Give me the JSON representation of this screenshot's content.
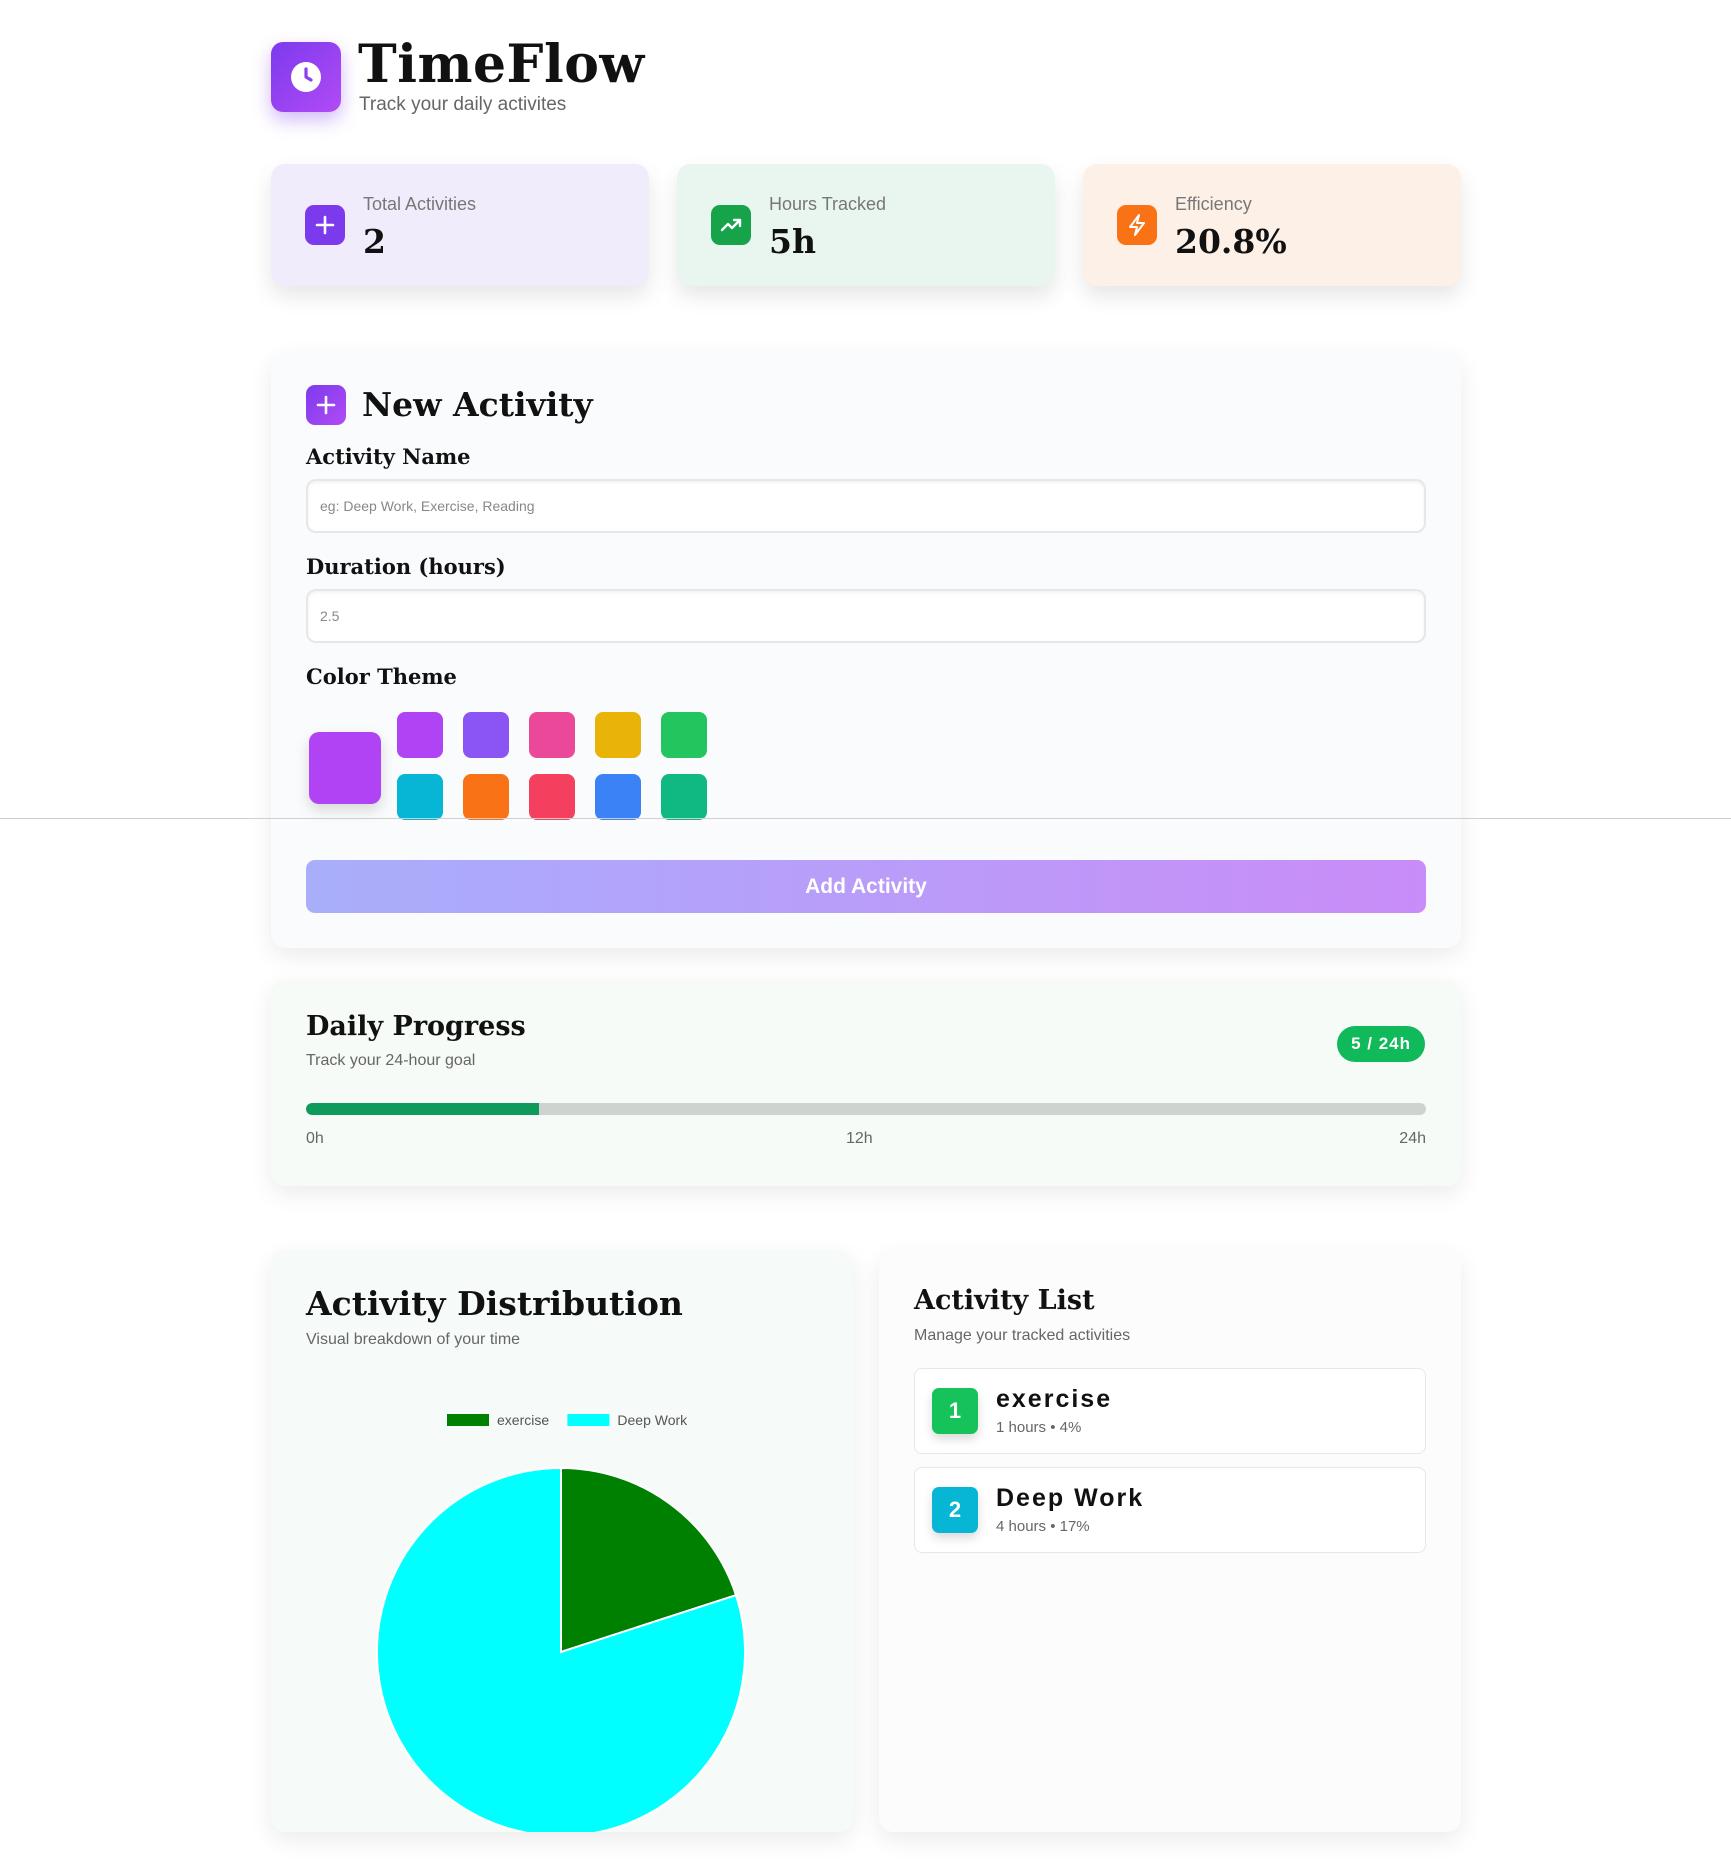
{
  "app": {
    "title": "TimeFlow",
    "subtitle": "Track your daily activites",
    "logo_icon": "clock-icon"
  },
  "stats": [
    {
      "label": "Total Activities",
      "value": "2",
      "icon": "plus-icon",
      "bg": "#f1ecfb",
      "icon_bg": "#7c3aed"
    },
    {
      "label": "Hours Tracked",
      "value": "5h",
      "icon": "trending-up-icon",
      "bg": "#e9f6ef",
      "icon_bg": "#16a34a"
    },
    {
      "label": "Efficiency",
      "value": "20.8%",
      "icon": "lightning-icon",
      "bg": "#fdf0e6",
      "icon_bg": "#f97316"
    }
  ],
  "new_activity": {
    "title": "New Activity",
    "name_label": "Activity Name",
    "name_placeholder": "eg: Deep Work, Exercise, Reading",
    "duration_label": "Duration (hours)",
    "duration_placeholder": "2.5",
    "color_label": "Color Theme",
    "selected_color": "#b044f5",
    "colors_row1": [
      "#b044f5",
      "#8b55f5",
      "#ec4899",
      "#eab308",
      "#22c55e"
    ],
    "colors_row2": [
      "#06b6d4",
      "#f97316",
      "#f43f5e",
      "#3b82f6",
      "#10b981"
    ],
    "add_button": "Add Activity"
  },
  "progress": {
    "title": "Daily Progress",
    "subtitle": "Track your 24-hour goal",
    "badge": "5 / 24h",
    "value": 5,
    "max": 24,
    "ticks": [
      "0h",
      "12h",
      "24h"
    ]
  },
  "distribution": {
    "title": "Activity Distribution",
    "subtitle": "Visual breakdown of your time"
  },
  "chart_data": {
    "type": "pie",
    "labels": [
      "exercise",
      "Deep Work"
    ],
    "values": [
      1,
      4
    ],
    "colors": [
      "#008000",
      "#00ffff"
    ],
    "legend": "top"
  },
  "activity_list": {
    "title": "Activity List",
    "subtitle": "Manage your tracked activities",
    "items": [
      {
        "num": "1",
        "name": "exercise",
        "detail": "1 hours • 4%",
        "color": "#16c25a"
      },
      {
        "num": "2",
        "name": "Deep Work",
        "detail": "4 hours • 17%",
        "color": "#06b6d4"
      }
    ]
  }
}
